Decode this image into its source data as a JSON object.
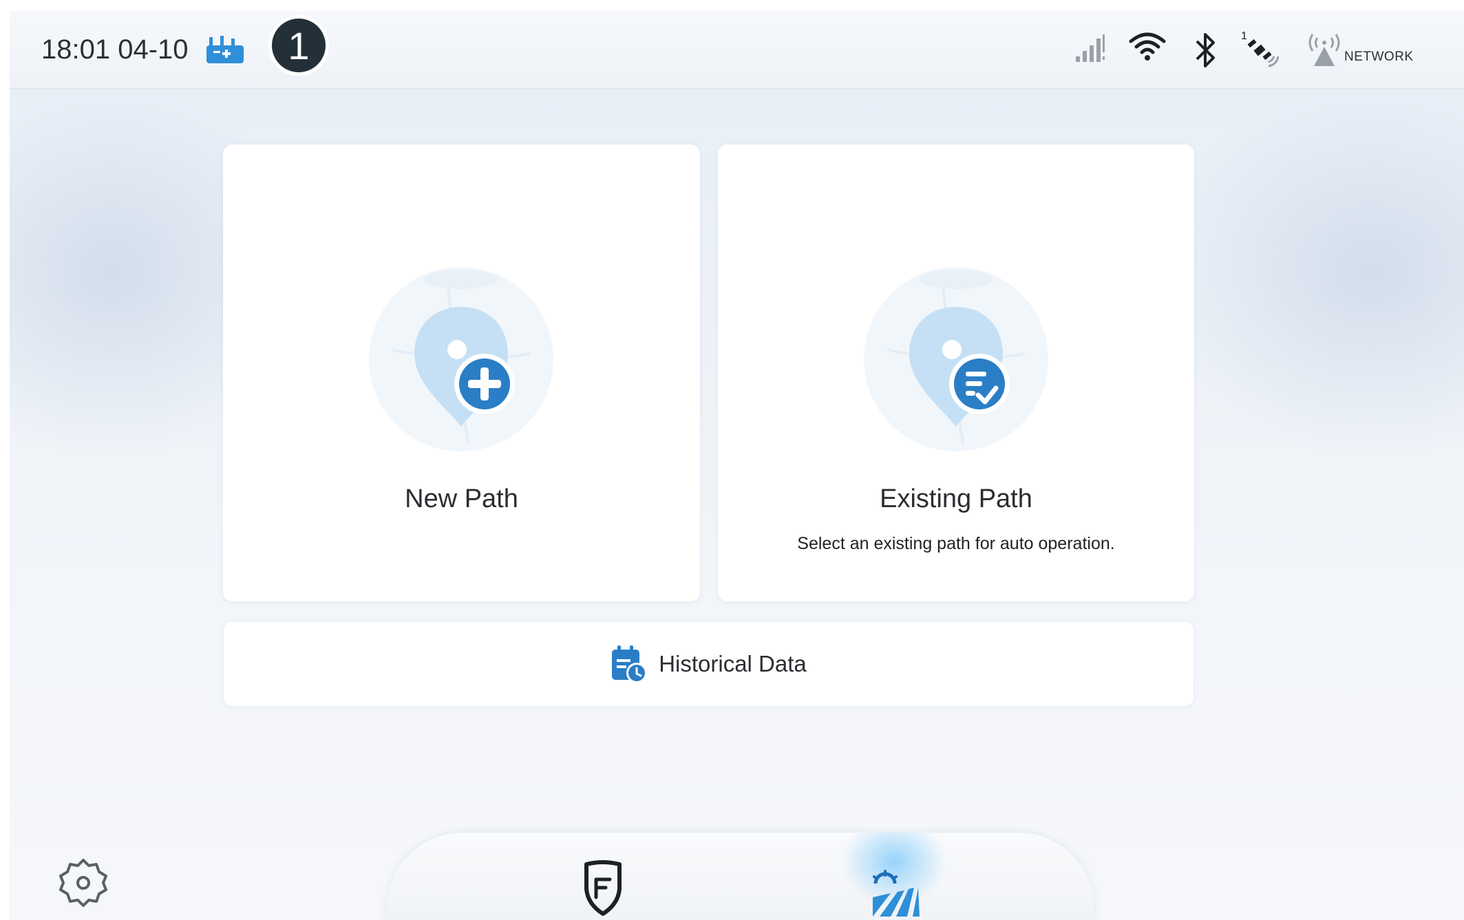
{
  "status_bar": {
    "time": "18:01 04-10",
    "badge_number": "1",
    "icons": [
      "robot-icon",
      "cellular-signal-icon",
      "wifi-icon",
      "bluetooth-icon",
      "satellite-icon",
      "network-antenna-icon"
    ],
    "network_label": "NETWORK",
    "satellite_count": "1"
  },
  "cards": {
    "new_path": {
      "title": "New Path",
      "icon": "location-pin-plus-icon"
    },
    "existing_path": {
      "title": "Existing Path",
      "subtitle": "Select an existing path for auto operation.",
      "icon": "location-pin-list-check-icon"
    }
  },
  "historical": {
    "label": "Historical Data",
    "icon": "calendar-clock-icon"
  },
  "bottom_nav": {
    "settings_icon": "gear-icon",
    "items": [
      {
        "icon": "shield-icon",
        "active": false
      },
      {
        "icon": "field-auto-icon",
        "active": true
      }
    ]
  },
  "colors": {
    "accent": "#2a7ec6",
    "accent_light": "#c9e3f6",
    "badge_bg": "#243038",
    "text": "#2a2d31"
  }
}
